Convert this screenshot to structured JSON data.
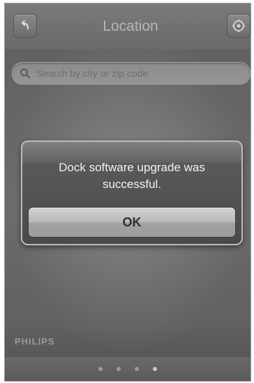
{
  "header": {
    "title": "Location",
    "back_icon": "back-arrow-icon",
    "settings_icon": "gear-icon"
  },
  "search": {
    "placeholder": "Search by city or zip code",
    "icon": "search-icon"
  },
  "alert": {
    "message": "Dock software upgrade was successful.",
    "ok_label": "OK"
  },
  "brand": {
    "name": "PHILIPS"
  },
  "pagination": {
    "total": 4,
    "current": 4
  },
  "colors": {
    "background": "#747474",
    "alert_background": "#4f4f4f",
    "button_light": "#c4c4c4"
  }
}
